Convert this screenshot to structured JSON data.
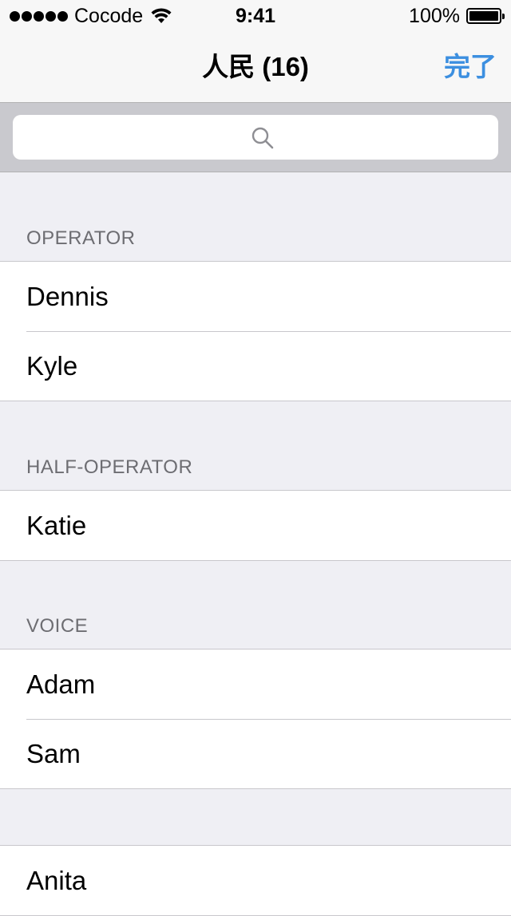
{
  "status_bar": {
    "carrier": "Cocode",
    "time": "9:41",
    "battery": "100%"
  },
  "nav": {
    "title": "人民 (16)",
    "done_label": "完了"
  },
  "search": {
    "placeholder": ""
  },
  "sections": [
    {
      "header": "OPERATOR",
      "items": [
        "Dennis",
        "Kyle"
      ]
    },
    {
      "header": "HALF-OPERATOR",
      "items": [
        "Katie"
      ]
    },
    {
      "header": "VOICE",
      "items": [
        "Adam",
        "Sam"
      ]
    },
    {
      "header": "",
      "items": [
        "Anita"
      ]
    }
  ]
}
